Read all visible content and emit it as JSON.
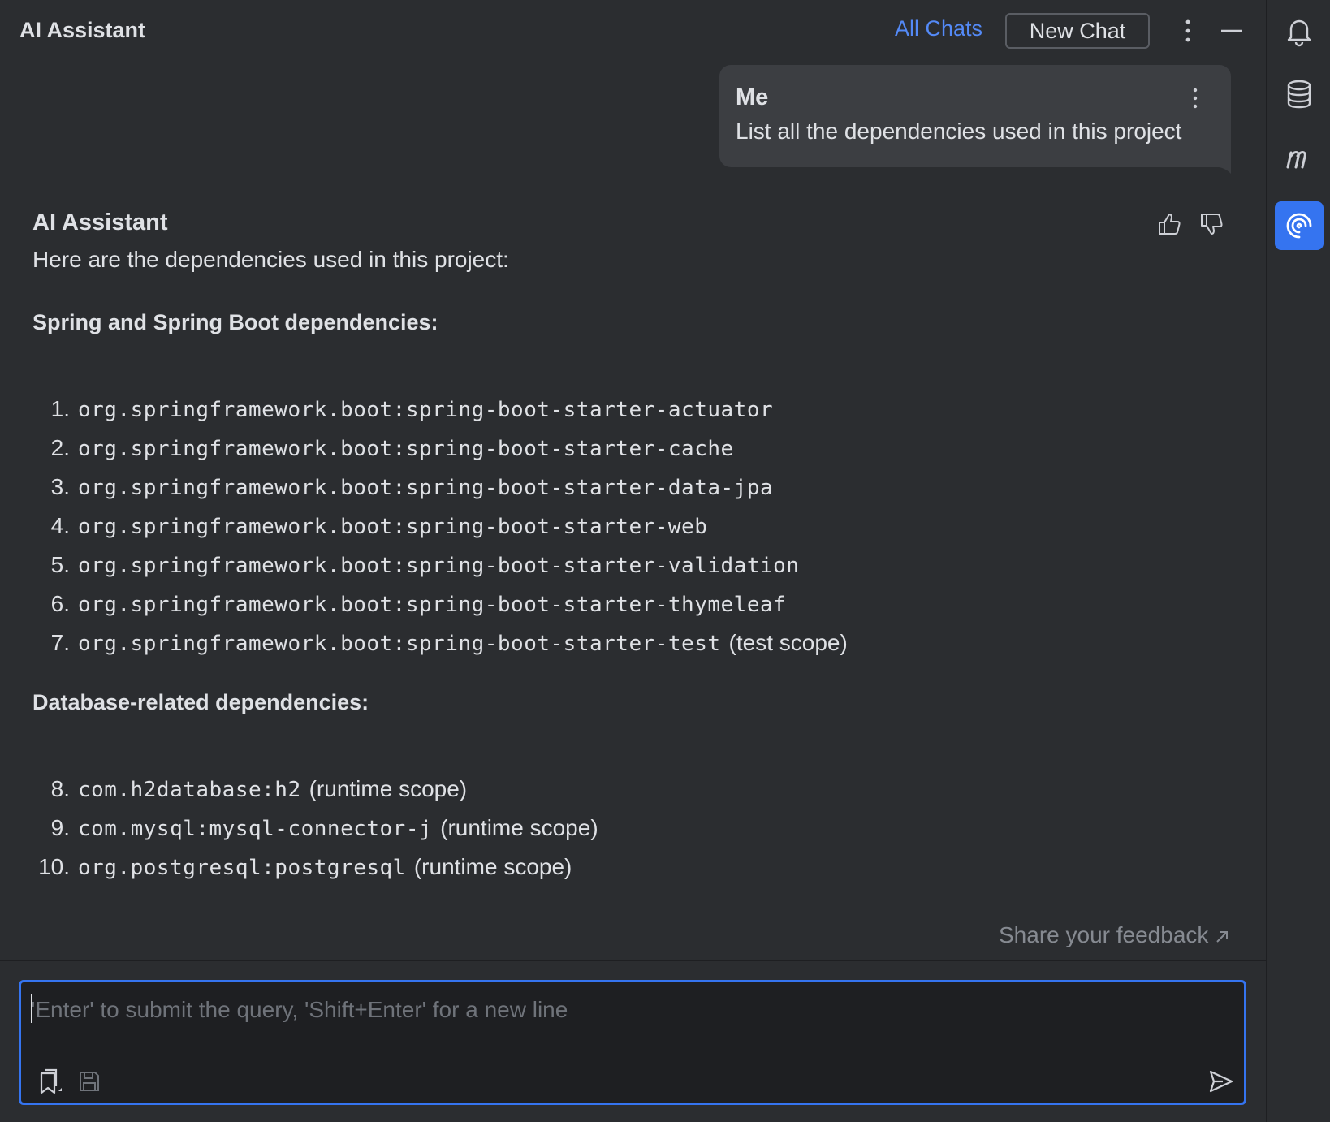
{
  "header": {
    "title": "AI Assistant",
    "all_chats": "All Chats",
    "new_chat": "New Chat"
  },
  "user_message": {
    "author": "Me",
    "text": "List all the dependencies used in this project"
  },
  "assistant_message": {
    "author": "AI Assistant",
    "intro": "Here are the dependencies used in this project:",
    "sections": [
      {
        "heading": "Spring and Spring Boot dependencies:",
        "items": [
          {
            "num": "1.",
            "code": "org.springframework.boot:spring-boot-starter-actuator",
            "note": ""
          },
          {
            "num": "2.",
            "code": "org.springframework.boot:spring-boot-starter-cache",
            "note": ""
          },
          {
            "num": "3.",
            "code": "org.springframework.boot:spring-boot-starter-data-jpa",
            "note": ""
          },
          {
            "num": "4.",
            "code": "org.springframework.boot:spring-boot-starter-web",
            "note": ""
          },
          {
            "num": "5.",
            "code": "org.springframework.boot:spring-boot-starter-validation",
            "note": ""
          },
          {
            "num": "6.",
            "code": "org.springframework.boot:spring-boot-starter-thymeleaf",
            "note": ""
          },
          {
            "num": "7.",
            "code": "org.springframework.boot:spring-boot-starter-test",
            "note": "(test scope)"
          }
        ]
      },
      {
        "heading": "Database-related dependencies:",
        "items": [
          {
            "num": "8.",
            "code": "com.h2database:h2",
            "note": "(runtime scope)"
          },
          {
            "num": "9.",
            "code": "com.mysql:mysql-connector-j",
            "note": "(runtime scope)"
          },
          {
            "num": "10.",
            "code": "org.postgresql:postgresql",
            "note": "(runtime scope)"
          }
        ]
      }
    ]
  },
  "feedback": {
    "label": "Share your feedback"
  },
  "input": {
    "placeholder": "'Enter' to submit the query, 'Shift+Enter' for a new line"
  },
  "icons": {
    "right_bar": [
      "bell-icon",
      "database-icon",
      "m-icon",
      "ai-assistant-icon"
    ],
    "input_bar": [
      "attach-context-icon",
      "save-prompt-icon",
      "send-icon"
    ]
  },
  "colors": {
    "background": "#2b2d30",
    "input_background": "#1e1f22",
    "accent": "#3574f0",
    "link": "#548af7",
    "bubble": "#3c3e42",
    "muted_text": "#868a91"
  }
}
